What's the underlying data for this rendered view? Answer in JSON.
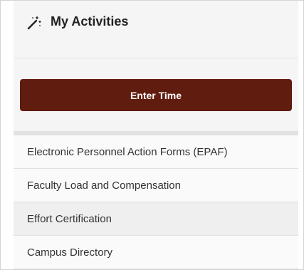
{
  "header": {
    "title": "My Activities",
    "icon": "magic-wand-icon"
  },
  "primary_action": {
    "label": "Enter Time",
    "color": "#611c10"
  },
  "links": [
    {
      "label": "Electronic Personnel Action Forms (EPAF)"
    },
    {
      "label": "Faculty Load and Compensation"
    },
    {
      "label": "Effort Certification"
    },
    {
      "label": "Campus Directory"
    }
  ]
}
